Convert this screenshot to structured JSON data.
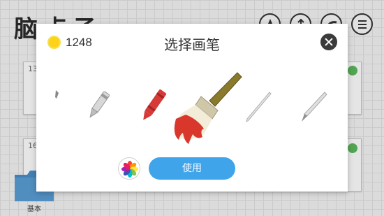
{
  "app": {
    "title": "脑点子",
    "folder_label": "基本"
  },
  "background_cards": [
    {
      "number": "13"
    },
    {
      "number": "16"
    }
  ],
  "top_icons": [
    "pencil-tip-icon",
    "share-icon",
    "eraser-icon",
    "menu-icon"
  ],
  "dialog": {
    "title": "选择画笔",
    "coins": "1248",
    "use_button_label": "使用",
    "brushes": [
      "ink-pen",
      "marker",
      "crayon",
      "paint-brush",
      "fine-liner",
      "calligraphy-pen"
    ],
    "selected_brush": "paint-brush"
  },
  "colors": {
    "accent": "#3fa4ea",
    "coin": "#ffd21a",
    "check": "#5cb85c",
    "crayon": "#d63a38",
    "paint": "#d9372b",
    "brush_handle": "#8a7a2c"
  }
}
